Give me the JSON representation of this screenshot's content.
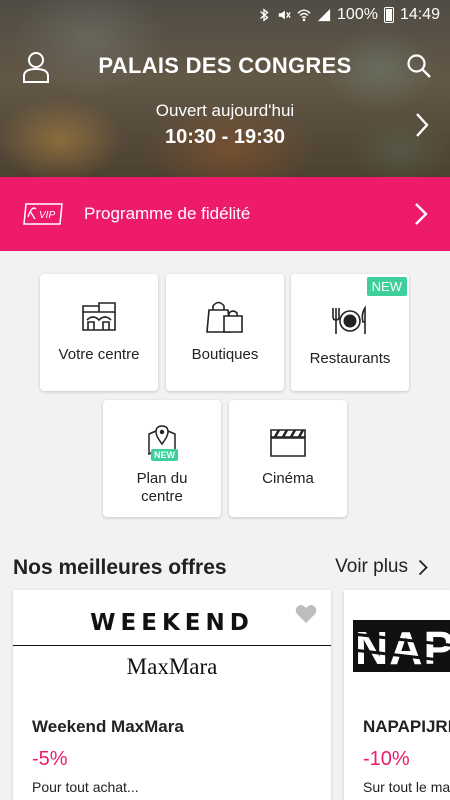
{
  "status_bar": {
    "battery": "100%",
    "time": "14:49"
  },
  "header": {
    "title": "PALAIS DES CONGRES"
  },
  "hours": {
    "status": "Ouvert aujourd'hui",
    "time": "10:30 - 19:30"
  },
  "loyalty": {
    "vip_text": "VIP",
    "label": "Programme de fidélité",
    "color": "#ee1b6d"
  },
  "tiles": [
    {
      "label": "Votre centre",
      "icon": "shopping-center-icon"
    },
    {
      "label": "Boutiques",
      "icon": "shopping-bags-icon"
    },
    {
      "label": "Restaurants",
      "icon": "plate-cutlery-icon",
      "badge": "NEW"
    },
    {
      "label_line1": "Plan du",
      "label_line2": "centre",
      "icon": "map-pin-icon",
      "badge": "NEW"
    },
    {
      "label": "Cinéma",
      "icon": "clapperboard-icon"
    }
  ],
  "offers": {
    "title": "Nos meilleures offres",
    "see_more": "Voir plus",
    "cards": [
      {
        "logo_line1": "WEEKEND",
        "logo_line2": "MaxMara",
        "name": "Weekend MaxMara",
        "discount": "-5%",
        "description": "Pour tout achat..."
      },
      {
        "logo_text": "NAPAPIJRI",
        "name": "NAPAPIJRI",
        "discount": "-10%",
        "description": "Sur tout le ma"
      }
    ]
  },
  "colors": {
    "accent": "#ee1b6d",
    "badge": "#3ecf9a"
  }
}
